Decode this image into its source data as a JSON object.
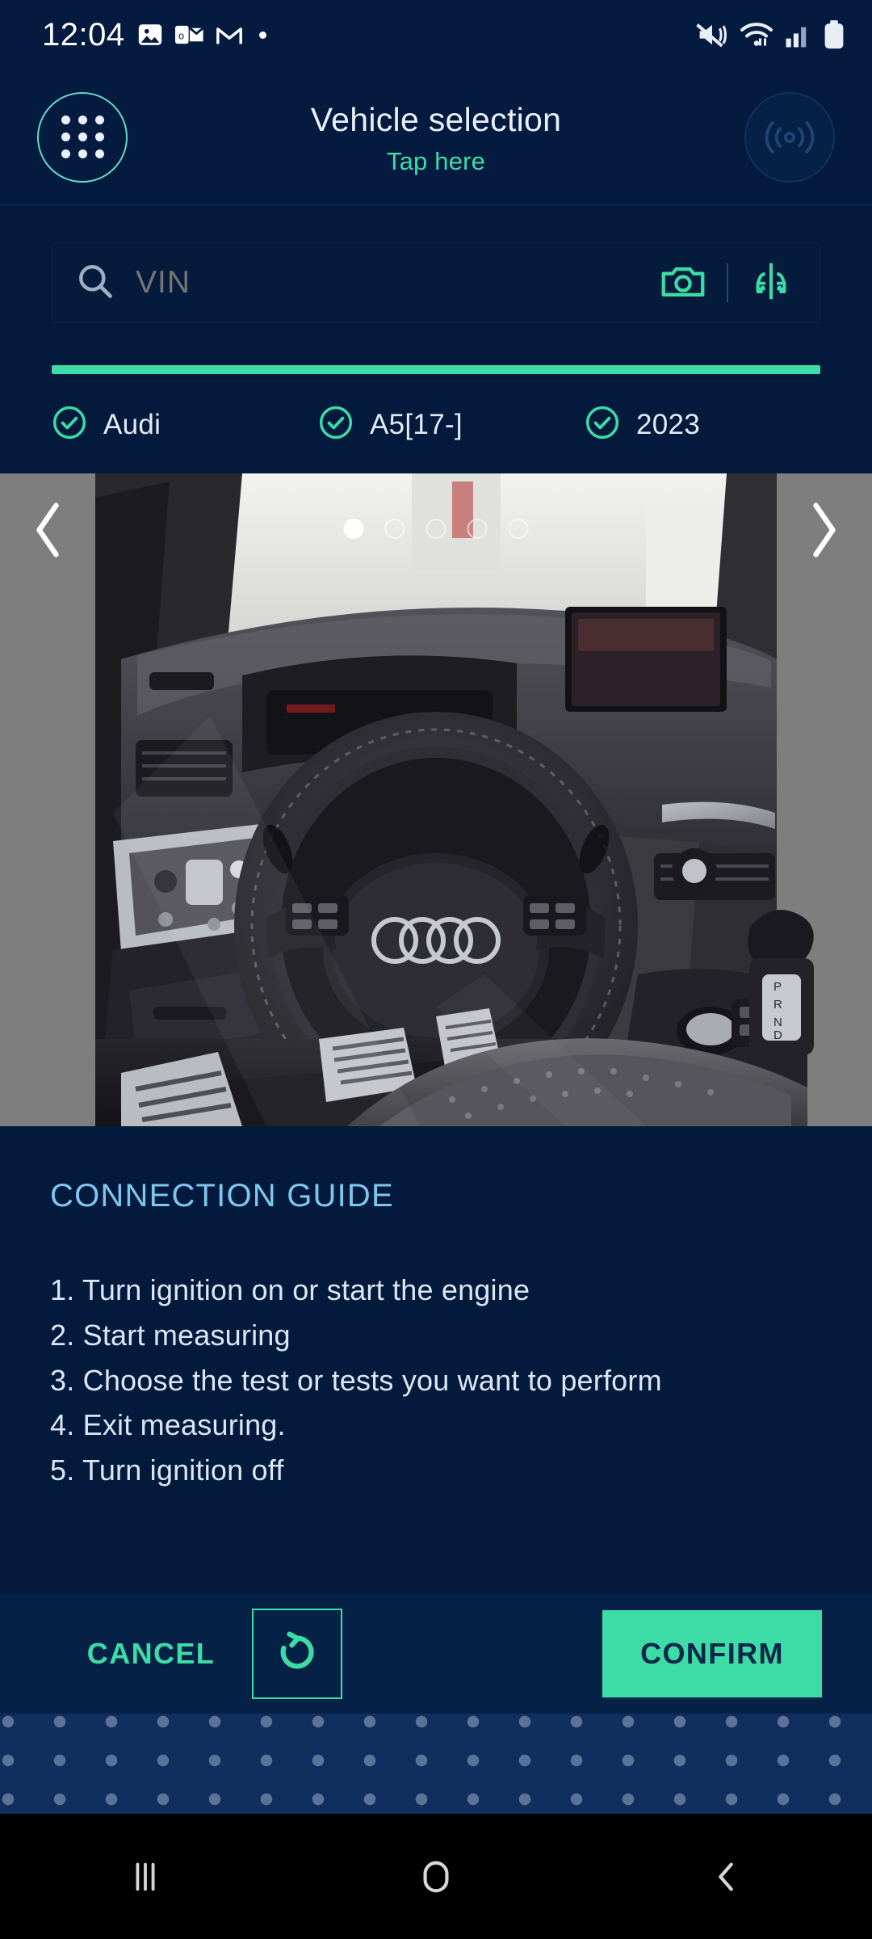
{
  "status_bar": {
    "time": "12:04",
    "left_icons": [
      "photos-icon",
      "outlook-icon",
      "gmail-icon",
      "more-dot-icon"
    ],
    "right_icons": [
      "mute-vibrate-icon",
      "wifi-icon",
      "cellular-signal-icon",
      "battery-icon"
    ]
  },
  "header": {
    "menu_icon": "app-grid-icon",
    "title": "Vehicle selection",
    "subtitle": "Tap here",
    "connection_icon": "wireless-connection-icon"
  },
  "search": {
    "icon": "search-icon",
    "placeholder": "VIN",
    "value": "",
    "camera_icon": "camera-icon",
    "scan_icon": "vehicle-scan-icon"
  },
  "progress": {
    "percent": 100,
    "color": "#3DDCA6"
  },
  "selection": {
    "items": [
      {
        "label": "Audi",
        "checked": true,
        "icon": "check-circle-icon"
      },
      {
        "label": "A5[17-]",
        "checked": true,
        "icon": "check-circle-icon"
      },
      {
        "label": "2023",
        "checked": true,
        "icon": "check-circle-icon"
      }
    ]
  },
  "carousel": {
    "prev_icon": "chevron-left-icon",
    "next_icon": "chevron-right-icon",
    "total_slides": 5,
    "active_slide": 1,
    "image_alt": "Audi A5 interior dashboard and steering wheel"
  },
  "guide": {
    "title": "CONNECTION GUIDE",
    "title_color": "#7FC6EE",
    "steps": [
      "1. Turn ignition on or start the engine",
      "2. Start measuring",
      "3. Choose the test or tests you want to perform",
      "4. Exit measuring.",
      "5. Turn ignition off"
    ]
  },
  "actions": {
    "cancel_label": "CANCEL",
    "reset_icon": "refresh-icon",
    "confirm_label": "CONFIRM",
    "accent_color": "#3DDCA6"
  },
  "nav_bar": {
    "recents_icon": "recents-icon",
    "home_icon": "home-icon",
    "back_icon": "back-icon"
  }
}
